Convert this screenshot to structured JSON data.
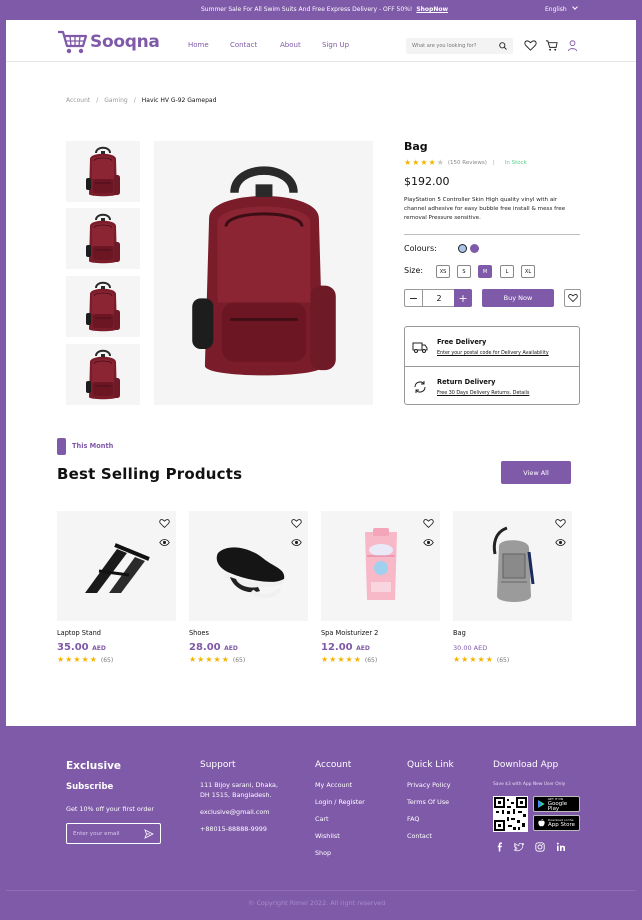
{
  "promo": {
    "message": "Summer Sale For All Swim Suits And Free Express Delivery - OFF 50%!",
    "link": "ShopNow",
    "language": "English"
  },
  "header": {
    "logo_text": "Sooqna",
    "nav": [
      "Home",
      "Contact",
      "About",
      "Sign Up"
    ],
    "search_placeholder": "What are you looking for?"
  },
  "breadcrumb": [
    "Account",
    "Gaming",
    "Havic HV G-92 Gamepad"
  ],
  "product": {
    "title": "Bag",
    "rating": 4,
    "reviews": "(150 Reviews)",
    "stock": "In Stock",
    "price": "$192.00",
    "description": "PlayStation 5 Controller Skin High quality vinyl with air channel adhesive for easy bubble free install & mess free removal Pressure sensitive.",
    "colours_label": "Colours:",
    "colours": [
      "#a8c4ea",
      "#7f5aa8"
    ],
    "size_label": "Size:",
    "sizes": [
      "XS",
      "S",
      "M",
      "L",
      "XL"
    ],
    "selected_size": "M",
    "quantity": "2",
    "buy_label": "Buy Now",
    "delivery": {
      "free_title": "Free Delivery",
      "free_sub": "Enter your postal code for Delivery Availability",
      "return_title": "Return Delivery",
      "return_sub_plain": "Free 30 Days Delivery Returns.",
      "return_sub_link": "Details"
    }
  },
  "section": {
    "label": "This Month",
    "title": "Best Selling Products",
    "view_all": "View All"
  },
  "products": [
    {
      "name": "Laptop Stand",
      "price": "35.00",
      "currency": "AED",
      "rating": 5,
      "count": "(65)"
    },
    {
      "name": "Shoes",
      "price": "28.00",
      "currency": "AED",
      "rating": 5,
      "count": "(65)"
    },
    {
      "name": "Spa Moisturizer 2",
      "price": "12.00",
      "currency": "AED",
      "rating": 5,
      "count": "(65)"
    },
    {
      "name": "Bag",
      "price": "30.00 AED",
      "currency": "",
      "rating": 5,
      "count": "(65)"
    }
  ],
  "footer": {
    "exclusive": {
      "title": "Exclusive",
      "subtitle": "Subscribe",
      "text": "Get 10% off your first order",
      "email_placeholder": "Enter your email"
    },
    "support": {
      "title": "Support",
      "address1": "111 Bijoy sarani, Dhaka,",
      "address2": "DH 1515, Bangladesh.",
      "email": "exclusive@gmail.com",
      "phone": "+88015-88888-9999"
    },
    "account": {
      "title": "Account",
      "items": [
        "My Account",
        "Login / Register",
        "Cart",
        "Wishlist",
        "Shop"
      ]
    },
    "quick_link": {
      "title": "Quick Link",
      "items": [
        "Privacy Policy",
        "Terms Of Use",
        "FAQ",
        "Contact"
      ]
    },
    "download": {
      "title": "Download App",
      "note": "Save $3 with App New User Only",
      "google_small": "GET IT ON",
      "google_big": "Google Play",
      "apple_small": "Download on the",
      "apple_big": "App Store"
    },
    "copyright": "Copyright Rimel 2022. All right reserved"
  },
  "colors": {
    "brand": "#7f5aa8",
    "star": "#f5b400",
    "stock": "#5ad08a"
  }
}
